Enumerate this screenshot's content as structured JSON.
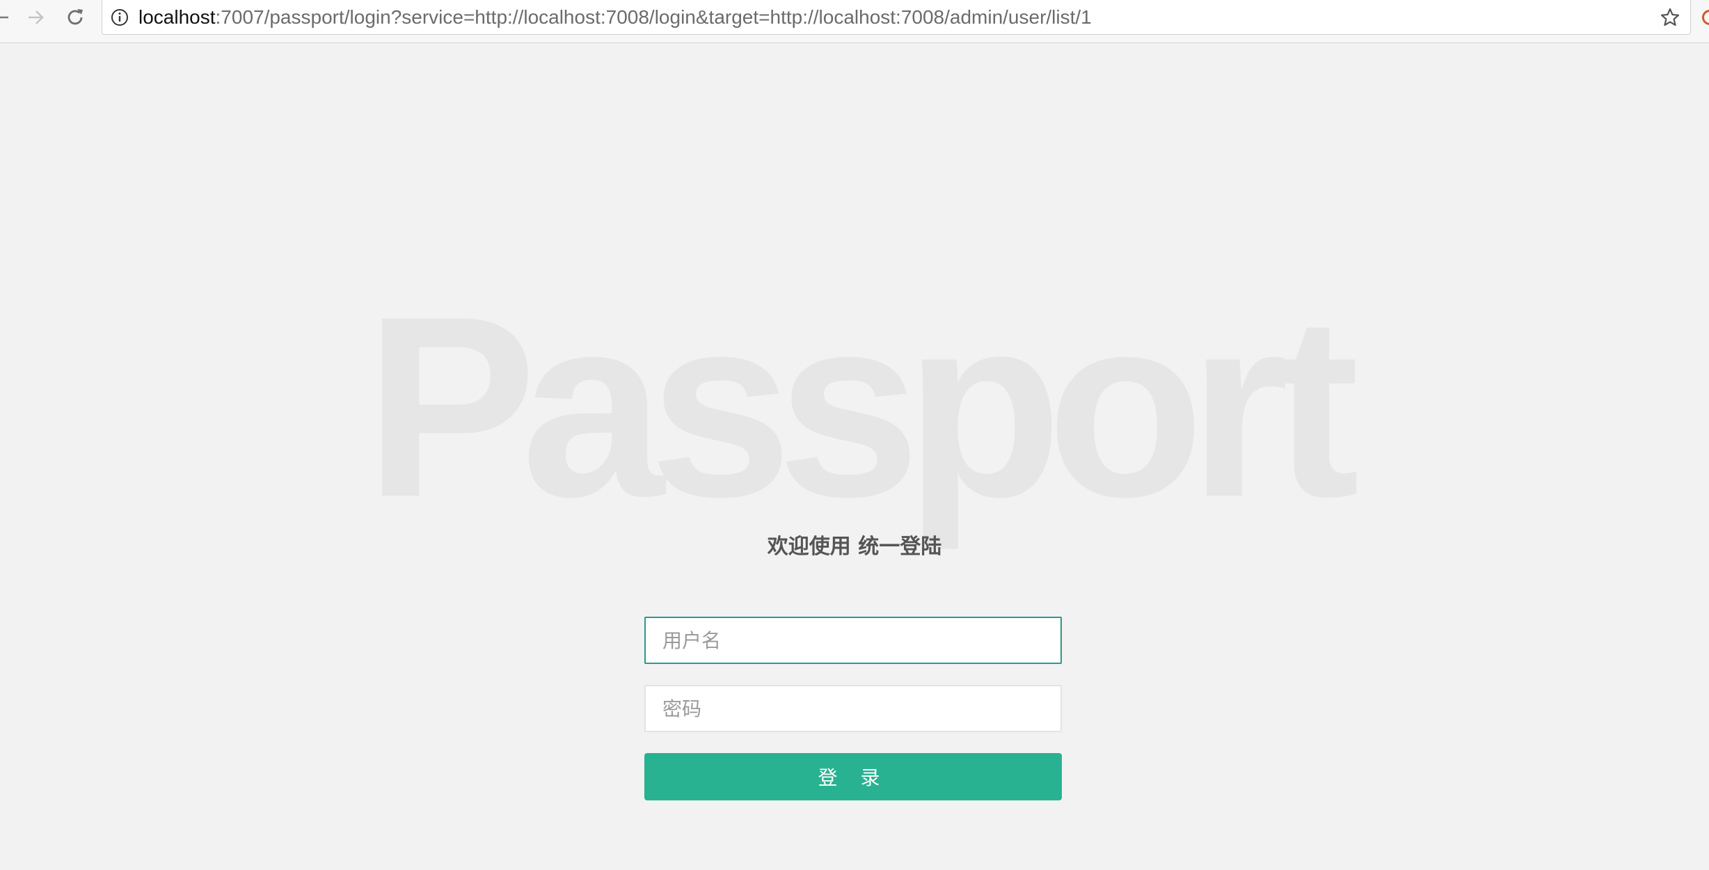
{
  "browser": {
    "url_host": "localhost",
    "url_rest": ":7007/passport/login?service=http://localhost:7008/login&target=http://localhost:7008/admin/user/list/1",
    "icons": {
      "back": "arrow-left-icon",
      "forward": "arrow-right-icon",
      "reload": "reload-icon",
      "info": "info-icon",
      "bookmark": "star-icon"
    }
  },
  "page": {
    "watermark": "Passport",
    "subtitle": "欢迎使用 统一登陆",
    "username": {
      "placeholder": "用户名",
      "value": ""
    },
    "password": {
      "placeholder": "密码",
      "value": ""
    },
    "login_label": "登 录"
  },
  "colors": {
    "background": "#f2f2f2",
    "accent": "#28b291",
    "focus_border": "#2a9a8a",
    "watermark": "#e6e6e6"
  }
}
